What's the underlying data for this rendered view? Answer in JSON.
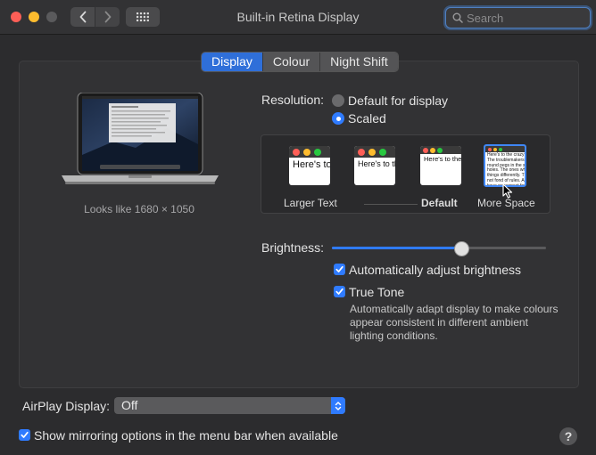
{
  "window": {
    "title": "Built-in Retina Display"
  },
  "search": {
    "placeholder": "Search"
  },
  "tabs": [
    {
      "label": "Display",
      "active": true
    },
    {
      "label": "Colour",
      "active": false
    },
    {
      "label": "Night Shift",
      "active": false
    }
  ],
  "display": {
    "looks_like": "Looks like 1680 × 1050",
    "resolution_label": "Resolution:",
    "resolution_options": [
      {
        "label": "Default for display",
        "selected": false
      },
      {
        "label": "Scaled",
        "selected": true
      }
    ],
    "scaled_options": [
      {
        "label": "Larger Text",
        "preview": "Here's to the crazy ones. The troublemakers.",
        "selected": false
      },
      {
        "label": "",
        "preview": "Here's to the crazy ones. The troublemakers. The ones who see things differently.",
        "selected": false
      },
      {
        "label": "Default",
        "preview": "Here's to the crazy ones. The troublemakers. The ones who see things differently. They're not fond of rules. And they",
        "selected": false
      },
      {
        "label": "More Space",
        "preview": "Here's to the crazy ones. The troublemakers. The round pegs in the square holes. The ones who see things differently. They're not fond of rules. And they have no respect for the status quo. You can quote them, disagree with them. About the only thing you can't do is ignore them. Because they change things.",
        "selected": true
      }
    ],
    "brightness_label": "Brightness:",
    "brightness_level": 0.6,
    "auto_brightness": {
      "label": "Automatically adjust brightness",
      "checked": true
    },
    "true_tone": {
      "label": "True Tone",
      "checked": true,
      "description": "Automatically adapt display to make colours appear consistent in different ambient lighting conditions."
    }
  },
  "airplay": {
    "label": "AirPlay Display:",
    "value": "Off"
  },
  "mirroring": {
    "label": "Show mirroring options in the menu bar when available",
    "checked": true
  },
  "help": {
    "label": "?"
  },
  "colors": {
    "accent": "#2f7bff",
    "tab_active": "#2f6fd9"
  }
}
